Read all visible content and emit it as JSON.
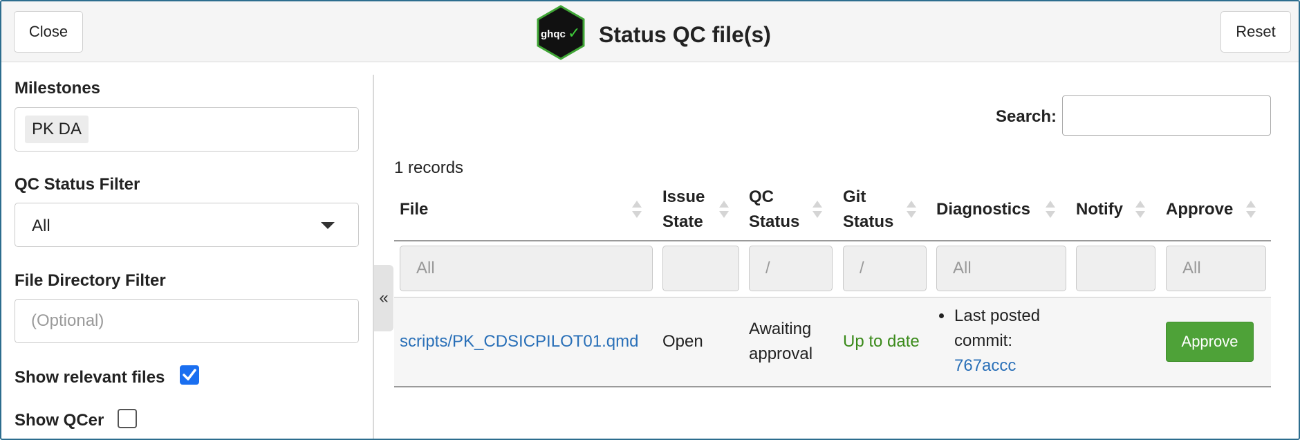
{
  "header": {
    "close_label": "Close",
    "reset_label": "Reset",
    "logo_text": "ghqc",
    "logo_check": "✓",
    "title": "Status QC file(s)"
  },
  "sidebar": {
    "milestones_label": "Milestones",
    "milestone_chip": "PK DA",
    "qc_status_label": "QC Status Filter",
    "qc_status_value": "All",
    "file_dir_label": "File Directory Filter",
    "file_dir_placeholder": "(Optional)",
    "show_relevant_label": "Show relevant files",
    "show_relevant_checked": true,
    "show_qcer_label": "Show QCer",
    "show_qcer_checked": false,
    "collapse_glyph": "«"
  },
  "main": {
    "search_label": "Search:",
    "search_value": "",
    "records_text": "1 records",
    "columns": [
      {
        "line1": "File",
        "line2": ""
      },
      {
        "line1": "Issue",
        "line2": "State"
      },
      {
        "line1": "QC",
        "line2": "Status"
      },
      {
        "line1": "Git",
        "line2": "Status"
      },
      {
        "line1": "Diagnostics",
        "line2": ""
      },
      {
        "line1": "Notify",
        "line2": ""
      },
      {
        "line1": "Approve",
        "line2": ""
      }
    ],
    "filters": [
      "All",
      "",
      "/",
      "/",
      "All",
      "",
      "All"
    ],
    "rows": [
      {
        "file": "scripts/PK_CDSICPILOT01.qmd",
        "issue_state": "Open",
        "qc_status_line1": "Awaiting",
        "qc_status_line2": "approval",
        "git_status": "Up to date",
        "diagnostics_line1": "Last posted",
        "diagnostics_line2": "commit:",
        "diagnostics_commit": "767accc",
        "approve_label": "Approve"
      }
    ]
  },
  "colors": {
    "accent_blue": "#2a70b8",
    "success_green": "#4ea238",
    "status_green": "#3a8a1a",
    "checkbox_blue": "#1a6ff0"
  }
}
